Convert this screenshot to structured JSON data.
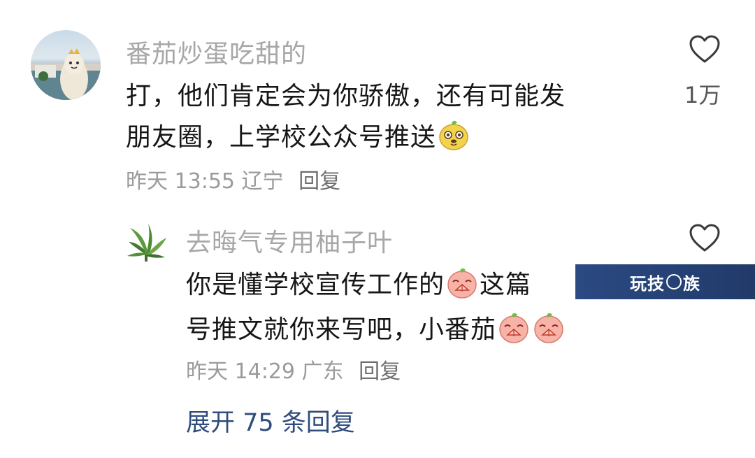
{
  "comment": {
    "username": "番茄炒蛋吃甜的",
    "text_line1": "打，他们肯定会为你骄傲，还有可能发",
    "text_line2": "朋友圈，上学校公众号推送",
    "emoji": "dog-face-emoji",
    "time": "昨天 13:55",
    "location": "辽宁",
    "reply_label": "回复",
    "like_count": "1万"
  },
  "reply": {
    "username": "去晦气专用柚子叶",
    "text_line1a": "你是懂学校宣传工作的",
    "text_line1b": "这篇",
    "text_line2": "号推文就你来写吧，小番茄",
    "emoji": "praying-peach-emoji",
    "time": "昨天 14:29",
    "location": "广东",
    "reply_label": "回复"
  },
  "expand_label": "展开 75 条回复",
  "watermark": {
    "part1": "玩技",
    "part2": "族"
  },
  "colors": {
    "username": "#a7a7a7",
    "text": "#161616",
    "meta": "#9b9b9b",
    "expand": "#2f4c7c",
    "watermark_bg": "#213a6a"
  }
}
